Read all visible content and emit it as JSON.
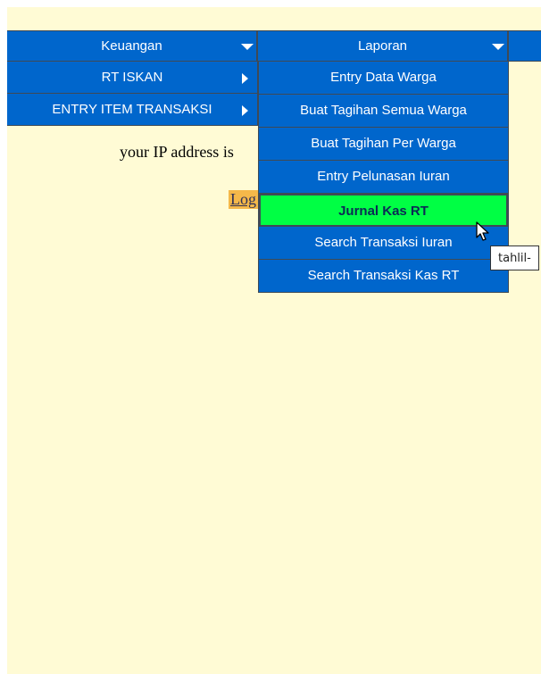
{
  "menu": {
    "top": [
      {
        "label": "Keuangan"
      },
      {
        "label": "Laporan"
      }
    ],
    "left_sub": [
      {
        "label": "RT ISKAN"
      },
      {
        "label": "ENTRY ITEM TRANSAKSI"
      }
    ],
    "laporan_items": [
      {
        "label": "Entry Data Warga"
      },
      {
        "label": "Buat Tagihan Semua Warga"
      },
      {
        "label": "Buat Tagihan Per Warga"
      },
      {
        "label": "Entry Pelunasan Iuran"
      },
      {
        "label": "Jurnal Kas RT"
      },
      {
        "label": "Search Transaksi Iuran"
      },
      {
        "label": "Search Transaksi Kas RT"
      }
    ]
  },
  "main": {
    "ip_text": "your IP address is",
    "login_link": "Log"
  },
  "tooltip": {
    "text": "tahlil-"
  },
  "colors": {
    "menu_bg": "#0066cc",
    "active_bg": "#00ff44",
    "page_bg": "#fffbd5",
    "link_bg": "#f5b84a"
  }
}
